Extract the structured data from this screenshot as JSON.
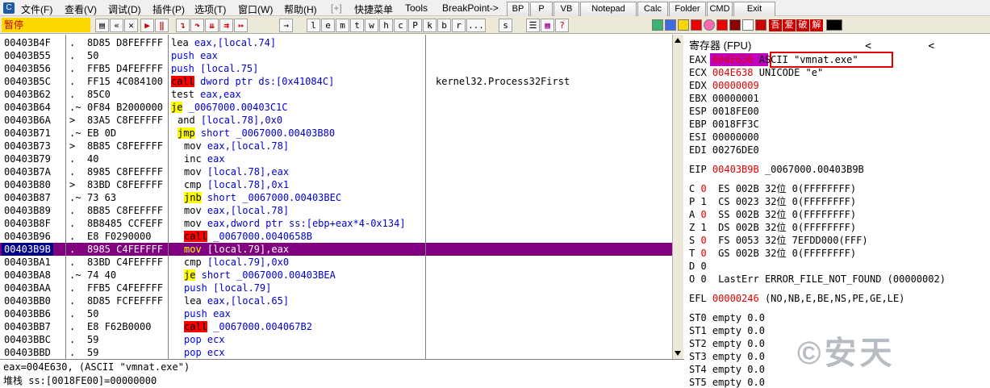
{
  "menu": {
    "items": [
      "文件(F)",
      "查看(V)",
      "调试(D)",
      "插件(P)",
      "选项(T)",
      "窗口(W)",
      "帮助(H)",
      "[+]",
      "快捷菜单",
      "Tools",
      "BreakPoint->"
    ],
    "plugin_buttons": [
      "BP",
      "P",
      "VB",
      "Notepad",
      "Calc",
      "Folder",
      "CMD",
      "Exit"
    ]
  },
  "toolbar": {
    "status": "暂停",
    "letters": [
      "l",
      "e",
      "m",
      "t",
      "w",
      "h",
      "c",
      "P",
      "k",
      "b",
      "r",
      "...",
      "s"
    ],
    "chinese": [
      "吾",
      "爱",
      "破",
      "解"
    ]
  },
  "disasm": {
    "rows": [
      {
        "addr": "00403B4F",
        "mark": ".",
        "hex": "8D85 D8FEFFFF",
        "asm": "lea eax,[local.74]",
        "kind": "plain",
        "comment": ""
      },
      {
        "addr": "00403B55",
        "mark": ".",
        "hex": "50",
        "asm": "push eax",
        "kind": "push",
        "comment": ""
      },
      {
        "addr": "00403B56",
        "mark": ".",
        "hex": "FFB5 D4FEFFFF",
        "asm": "push [local.75]",
        "kind": "push",
        "comment": ""
      },
      {
        "addr": "00403B5C",
        "mark": ".",
        "hex": "FF15 4C084100",
        "asm": "call dword ptr ds:[0x41084C]",
        "kind": "call",
        "comment": "kernel32.Process32First"
      },
      {
        "addr": "00403B62",
        "mark": ".",
        "hex": "85C0",
        "asm": "test eax,eax",
        "kind": "plain",
        "comment": ""
      },
      {
        "addr": "00403B64",
        "mark": ".~",
        "hex": "0F84 B2000000",
        "asm": "je _0067000.00403C1C",
        "kind": "jcc",
        "comment": ""
      },
      {
        "addr": "00403B6A",
        "mark": ">",
        "hex": "83A5 C8FEFFFF",
        "asm": "and [local.78],0x0",
        "kind": "plain",
        "comment": ""
      },
      {
        "addr": "00403B71",
        "mark": ".~",
        "hex": "EB 0D",
        "asm": "jmp short _0067000.00403B80",
        "kind": "jmp",
        "comment": ""
      },
      {
        "addr": "00403B73",
        "mark": ">",
        "hex": "8B85 C8FEFFFF",
        "asm": "mov eax,[local.78]",
        "kind": "plain",
        "comment": ""
      },
      {
        "addr": "00403B79",
        "mark": ".",
        "hex": "40",
        "asm": "inc eax",
        "kind": "plain",
        "comment": ""
      },
      {
        "addr": "00403B7A",
        "mark": ".",
        "hex": "8985 C8FEFFFF",
        "asm": "mov [local.78],eax",
        "kind": "plain",
        "comment": ""
      },
      {
        "addr": "00403B80",
        "mark": ">",
        "hex": "83BD C8FEFFFF",
        "asm": "cmp [local.78],0x1",
        "kind": "plain",
        "comment": ""
      },
      {
        "addr": "00403B87",
        "mark": ".~",
        "hex": "73 63",
        "asm": "jnb short _0067000.00403BEC",
        "kind": "jcc",
        "comment": ""
      },
      {
        "addr": "00403B89",
        "mark": ".",
        "hex": "8B85 C8FEFFFF",
        "asm": "mov eax,[local.78]",
        "kind": "plain",
        "comment": ""
      },
      {
        "addr": "00403B8F",
        "mark": ".",
        "hex": "8B8485 CCFEFF",
        "asm": "mov eax,dword ptr ss:[ebp+eax*4-0x134]",
        "kind": "plain",
        "comment": ""
      },
      {
        "addr": "00403B96",
        "mark": ".",
        "hex": "E8 F0290000",
        "asm": "call _0067000.0040658B",
        "kind": "call",
        "comment": ""
      },
      {
        "addr": "00403B9B",
        "mark": ".",
        "hex": "8985 C4FEFFFF",
        "asm": "mov [local.79],eax",
        "kind": "plain",
        "comment": "",
        "selected": true
      },
      {
        "addr": "00403BA1",
        "mark": ".",
        "hex": "83BD C4FEFFFF",
        "asm": "cmp [local.79],0x0",
        "kind": "plain",
        "comment": ""
      },
      {
        "addr": "00403BA8",
        "mark": ".~",
        "hex": "74 40",
        "asm": "je short _0067000.00403BEA",
        "kind": "jcc",
        "comment": ""
      },
      {
        "addr": "00403BAA",
        "mark": ".",
        "hex": "FFB5 C4FEFFFF",
        "asm": "push [local.79]",
        "kind": "push",
        "comment": ""
      },
      {
        "addr": "00403BB0",
        "mark": ".",
        "hex": "8D85 FCFEFFFF",
        "asm": "lea eax,[local.65]",
        "kind": "plain",
        "comment": ""
      },
      {
        "addr": "00403BB6",
        "mark": ".",
        "hex": "50",
        "asm": "push eax",
        "kind": "push",
        "comment": ""
      },
      {
        "addr": "00403BB7",
        "mark": ".",
        "hex": "E8 F62B0000",
        "asm": "call _0067000.004067B2",
        "kind": "call",
        "comment": ""
      },
      {
        "addr": "00403BBC",
        "mark": ".",
        "hex": "59",
        "asm": "pop ecx",
        "kind": "push",
        "comment": ""
      },
      {
        "addr": "00403BBD",
        "mark": ".",
        "hex": "59",
        "asm": "pop ecx",
        "kind": "push",
        "comment": ""
      }
    ]
  },
  "info": {
    "line1": "eax=004E630, (ASCII \"vmnat.exe\")",
    "line2": "堆栈 ss:[0018FE00]=00000000"
  },
  "registers": {
    "title": "寄存器 (FPU)",
    "rows": [
      {
        "name": "EAX",
        "val": "004E630",
        "extra": "ASCII \"vmnat.exe\"",
        "red": true
      },
      {
        "name": "ECX",
        "val": "004E638",
        "extra": "UNICODE \"e\"",
        "red": true
      },
      {
        "name": "EDX",
        "val": "00000009",
        "extra": "",
        "red": true
      },
      {
        "name": "EBX",
        "val": "00000001",
        "extra": "",
        "red": false
      },
      {
        "name": "ESP",
        "val": "0018FE00",
        "extra": "",
        "red": false
      },
      {
        "name": "EBP",
        "val": "0018FF3C",
        "extra": "",
        "red": false
      },
      {
        "name": "ESI",
        "val": "00000000",
        "extra": "",
        "red": false
      },
      {
        "name": "EDI",
        "val": "00276DE0",
        "extra": "",
        "red": false
      }
    ],
    "eip": {
      "name": "EIP",
      "val": "00403B9B",
      "extra": "_0067000.00403B9B"
    },
    "flags": [
      {
        "f": "C",
        "v": "0",
        "seg": "ES 002B",
        "bits": "32位",
        "desc": "0(FFFFFFFF)"
      },
      {
        "f": "P",
        "v": "1",
        "seg": "CS 0023",
        "bits": "32位",
        "desc": "0(FFFFFFFF)"
      },
      {
        "f": "A",
        "v": "0",
        "seg": "SS 002B",
        "bits": "32位",
        "desc": "0(FFFFFFFF)"
      },
      {
        "f": "Z",
        "v": "1",
        "seg": "DS 002B",
        "bits": "32位",
        "desc": "0(FFFFFFFF)"
      },
      {
        "f": "S",
        "v": "0",
        "seg": "FS 0053",
        "bits": "32位",
        "desc": "7EFDD000(FFF)"
      },
      {
        "f": "T",
        "v": "0",
        "seg": "GS 002B",
        "bits": "32位",
        "desc": "0(FFFFFFFF)"
      },
      {
        "f": "D",
        "v": "0",
        "seg": "",
        "bits": "",
        "desc": ""
      },
      {
        "f": "O",
        "v": "0",
        "seg": "LastErr ERROR_FILE_NOT_FOUND (00000002)",
        "bits": "",
        "desc": ""
      }
    ],
    "efl": {
      "name": "EFL",
      "val": "00000246",
      "extra": "(NO,NB,E,BE,NS,PE,GE,LE)"
    },
    "st": [
      "ST0 empty 0.0",
      "ST1 empty 0.0",
      "ST2 empty 0.0",
      "ST3 empty 0.0",
      "ST4 empty 0.0",
      "ST5 empty 0.0"
    ]
  },
  "watermark": "©安天"
}
